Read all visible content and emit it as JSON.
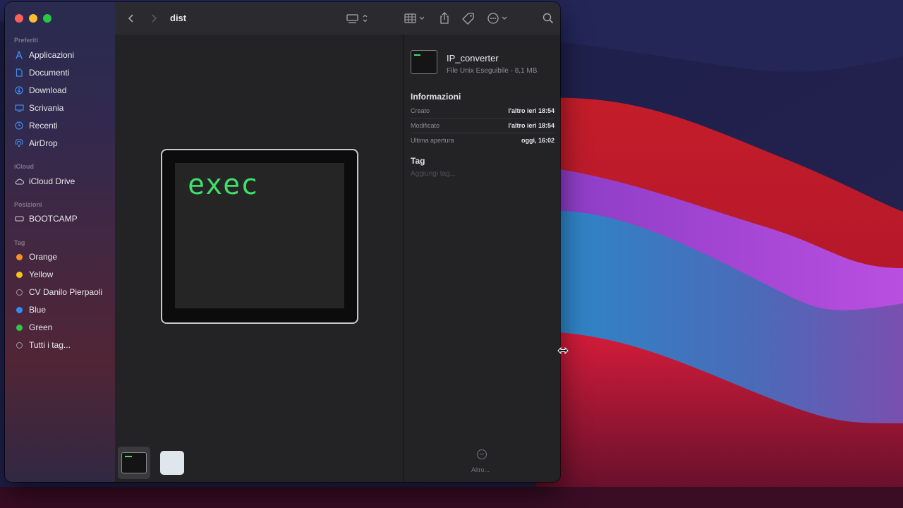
{
  "window": {
    "title": "dist"
  },
  "sidebar": {
    "sections": {
      "favorites": "Preferiti",
      "icloud": "iCloud",
      "locations": "Posizioni",
      "tags": "Tag"
    },
    "favorites": [
      {
        "label": "Applicazioni",
        "icon": "applications-icon"
      },
      {
        "label": "Documenti",
        "icon": "document-icon"
      },
      {
        "label": "Download",
        "icon": "download-icon"
      },
      {
        "label": "Scrivania",
        "icon": "desktop-icon"
      },
      {
        "label": "Recenti",
        "icon": "clock-icon"
      },
      {
        "label": "AirDrop",
        "icon": "airdrop-icon"
      }
    ],
    "icloud": [
      {
        "label": "iCloud Drive",
        "icon": "cloud-icon"
      }
    ],
    "locations": [
      {
        "label": "BOOTCAMP",
        "icon": "disk-icon"
      }
    ],
    "tags": [
      {
        "label": "Orange",
        "color": "#f7931e"
      },
      {
        "label": "Yellow",
        "color": "#f5c518"
      },
      {
        "label": "CV Danilo Pierpaoli",
        "color": "none"
      },
      {
        "label": "Blue",
        "color": "#2f8cf7"
      },
      {
        "label": "Green",
        "color": "#2cc84a"
      },
      {
        "label": "Tutti i tag...",
        "color": "none"
      }
    ]
  },
  "preview": {
    "icon_text": "exec"
  },
  "inspector": {
    "file_name": "IP_converter",
    "file_desc": "File Unix Eseguibile - 8,1 MB",
    "info_heading": "Informazioni",
    "rows": [
      {
        "key": "Creato",
        "value": "l'altro ieri 18:54"
      },
      {
        "key": "Modificato",
        "value": "l'altro ieri 18:54"
      },
      {
        "key": "Ultima apertura",
        "value": "oggi, 16:02"
      }
    ],
    "tag_heading": "Tag",
    "tag_placeholder": "Aggiungi tag...",
    "more_label": "Altro..."
  }
}
